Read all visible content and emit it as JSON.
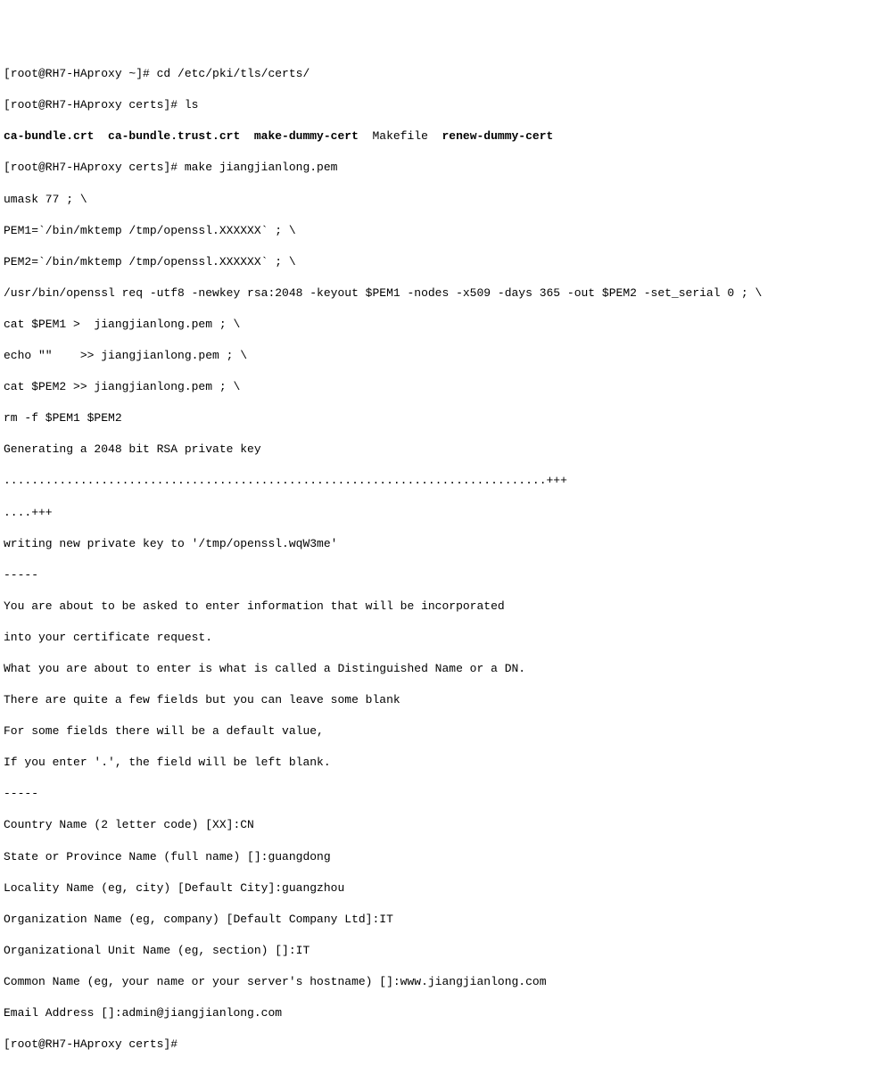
{
  "terminal": {
    "lines": [
      "[root@RH7-HAproxy ~]# cd /etc/pki/tls/certs/",
      "[root@RH7-HAproxy certs]# ls"
    ],
    "ls_output": "ca-bundle.crt  ca-bundle.trust.crt  make-dummy-cert  ",
    "ls_makefile": "Makefile  ",
    "ls_renew": "renew-dummy-cert",
    "lines2": [
      "[root@RH7-HAproxy certs]# make jiangjianlong.pem",
      "umask 77 ; \\",
      "PEM1=`/bin/mktemp /tmp/openssl.XXXXXX` ; \\",
      "PEM2=`/bin/mktemp /tmp/openssl.XXXXXX` ; \\",
      "/usr/bin/openssl req -utf8 -newkey rsa:2048 -keyout $PEM1 -nodes -x509 -days 365 -out $PEM2 -set_serial 0 ; \\",
      "cat $PEM1 >  jiangjianlong.pem ; \\",
      "echo \"\"    >> jiangjianlong.pem ; \\",
      "cat $PEM2 >> jiangjianlong.pem ; \\",
      "rm -f $PEM1 $PEM2",
      "Generating a 2048 bit RSA private key",
      "..............................................................................+++",
      "....+++",
      "writing new private key to '/tmp/openssl.wqW3me'",
      "-----",
      "You are about to be asked to enter information that will be incorporated",
      "into your certificate request.",
      "What you are about to enter is what is called a Distinguished Name or a DN.",
      "There are quite a few fields but you can leave some blank",
      "For some fields there will be a default value,",
      "If you enter '.', the field will be left blank.",
      "-----",
      "Country Name (2 letter code) [XX]:CN",
      "State or Province Name (full name) []:guangdong",
      "Locality Name (eg, city) [Default City]:guangzhou",
      "Organization Name (eg, company) [Default Company Ltd]:IT",
      "Organizational Unit Name (eg, section) []:IT",
      "Common Name (eg, your name or your server's hostname) []:www.jiangjianlong.com",
      "Email Address []:admin@jiangjianlong.com",
      "[root@RH7-HAproxy certs]#"
    ]
  }
}
